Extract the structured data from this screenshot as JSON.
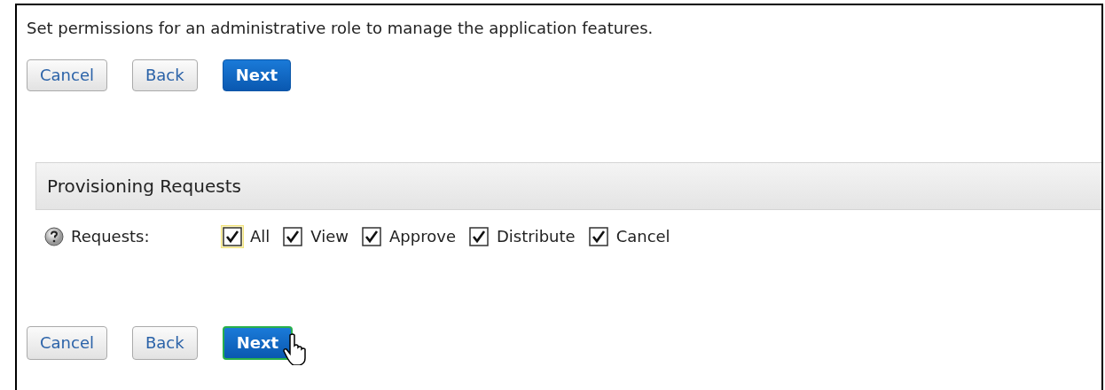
{
  "intro": "Set permissions for an administrative role to manage the application features.",
  "top_buttons": [
    {
      "label": "Cancel",
      "kind": "secondary",
      "focused": false
    },
    {
      "label": "Back",
      "kind": "secondary",
      "focused": false
    },
    {
      "label": "Next",
      "kind": "primary",
      "focused": false
    }
  ],
  "section": {
    "title": "Provisioning Requests",
    "label": "Requests:",
    "options": [
      {
        "label": "All",
        "checked": true,
        "focused": true
      },
      {
        "label": "View",
        "checked": true,
        "focused": false
      },
      {
        "label": "Approve",
        "checked": true,
        "focused": false
      },
      {
        "label": "Distribute",
        "checked": true,
        "focused": false
      },
      {
        "label": "Cancel",
        "checked": true,
        "focused": false
      }
    ]
  },
  "bottom_buttons": [
    {
      "label": "Cancel",
      "kind": "secondary",
      "focused": false
    },
    {
      "label": "Back",
      "kind": "secondary",
      "focused": false
    },
    {
      "label": "Next",
      "kind": "primary",
      "focused": true
    }
  ]
}
